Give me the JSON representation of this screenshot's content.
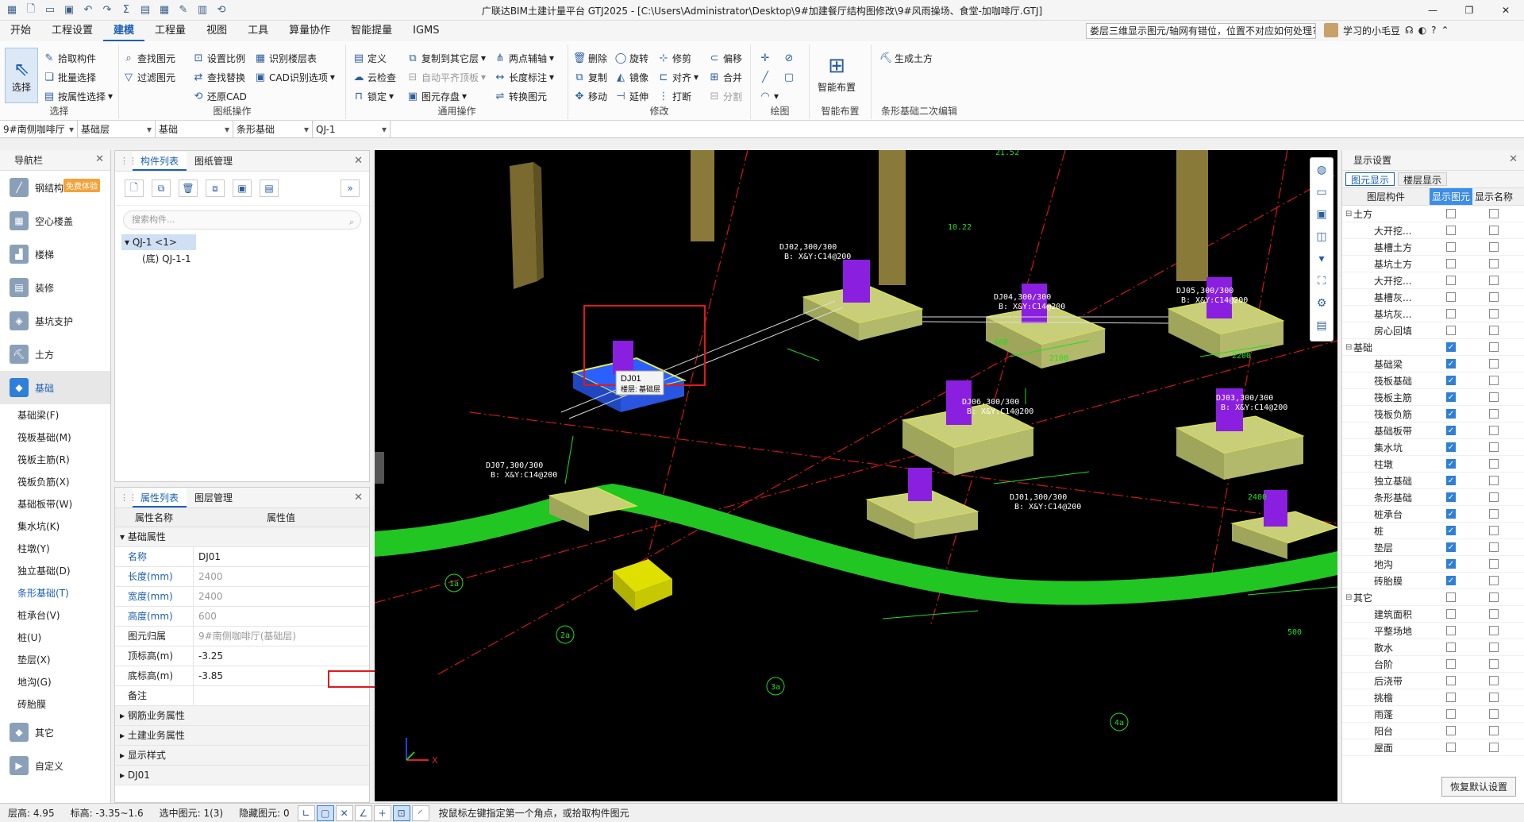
{
  "app": {
    "title": "广联达BIM土建计量平台 GTJ2025 - [C:\\Users\\Administrator\\Desktop\\9#加建餐厅结构图修改\\9#风雨操场、食堂-加咖啡厅.GTJ]"
  },
  "menu": [
    "开始",
    "工程设置",
    "建模",
    "工程量",
    "视图",
    "工具",
    "算量协作",
    "智能提量",
    "IGMS"
  ],
  "menu_active": "建模",
  "question": "娄层三维显示图元/轴网有错位，位置不对应如何处理?",
  "user": "学习的小毛豆",
  "ribbon": {
    "select": {
      "big": "选择",
      "pick": "拾取构件",
      "batch": "批量选择",
      "by_attr": "按属性选择",
      "label": "选择"
    },
    "drawing": {
      "find": "查找图元",
      "filter": "过滤图元",
      "scale": "设置比例",
      "replace": "查找替换",
      "restore": "还原CAD",
      "identify_floor": "识别楼层表",
      "cad_options": "CAD识别选项",
      "label": "图纸操作"
    },
    "common": {
      "define": "定义",
      "copy_to": "复制到其它层",
      "two_point": "两点辅轴",
      "cloud_check": "云检查",
      "auto_align": "自动平齐顶板",
      "length_mark": "长度标注",
      "lock": "锁定",
      "save_elem": "图元存盘",
      "convert": "转换图元",
      "label": "通用操作"
    },
    "modify": {
      "delete": "删除",
      "rotate": "旋转",
      "trim": "修剪",
      "offset": "偏移",
      "copy": "复制",
      "mirror": "镜像",
      "align": "对齐",
      "merge": "合并",
      "move": "移动",
      "extend": "延伸",
      "break": "打断",
      "split": "分割",
      "label": "修改"
    },
    "draw": {
      "label": "绘图"
    },
    "smart": {
      "big": "智能布置",
      "label": "智能布置"
    },
    "strip": {
      "gen": "生成土方",
      "label": "条形基础二次编辑"
    }
  },
  "filters": [
    "9#南侧咖啡厅",
    "基础层",
    "基础",
    "条形基础",
    "QJ-1"
  ],
  "nav": {
    "title": "导航栏",
    "badge": "免费体验",
    "items": [
      "钢结构",
      "空心楼盖",
      "楼梯",
      "装修",
      "基坑支护",
      "土方",
      "基础"
    ],
    "sub": [
      "基础梁(F)",
      "筏板基础(M)",
      "筏板主筋(R)",
      "筏板负筋(X)",
      "基础板带(W)",
      "集水坑(K)",
      "柱墩(Y)",
      "独立基础(D)",
      "条形基础(T)",
      "桩承台(V)",
      "桩(U)",
      "垫层(X)",
      "地沟(G)",
      "砖胎膜"
    ],
    "sub_active": "条形基础(T)",
    "bottom": [
      "其它",
      "自定义"
    ]
  },
  "components": {
    "tabs": [
      "构件列表",
      "图纸管理"
    ],
    "search": "搜索构件...",
    "root": "QJ-1 <1>",
    "child": "(底) QJ-1-1"
  },
  "props": {
    "tabs": [
      "属性列表",
      "图层管理"
    ],
    "col_name": "属性名称",
    "col_value": "属性值",
    "group": "基础属性",
    "rows": [
      {
        "name": "名称",
        "value": "DJ01"
      },
      {
        "name": "长度(mm)",
        "value": "2400"
      },
      {
        "name": "宽度(mm)",
        "value": "2400"
      },
      {
        "name": "高度(mm)",
        "value": "600"
      },
      {
        "name": "图元归属",
        "value": "9#南侧咖啡厅(基础层)"
      },
      {
        "name": "顶标高(m)",
        "value": "-3.25"
      },
      {
        "name": "底标高(m)",
        "value": "-3.85"
      },
      {
        "name": "备注",
        "value": ""
      }
    ],
    "groups": [
      "钢筋业务属性",
      "土建业务属性",
      "显示样式",
      "DJ01"
    ]
  },
  "viewport": {
    "tooltip_name": "DJ01",
    "tooltip_floor": "楼层: 基础层",
    "labels": [
      "DJ04,300/300",
      "B: X&Y:C14@200",
      "DJ05,300/300",
      "B: X&Y:C14@200",
      "DJ06,300/300",
      "B: X&Y:C14@200",
      "DJ03,300/300",
      "B: X&Y:C14@200",
      "DJ01,300/300",
      "B: X&Y:C14@200",
      "DJ07,300/300",
      "B: X&Y:C14@200",
      "DJ02,300/300",
      "B: X&Y:C14@200",
      "2100",
      "2200",
      "2400",
      "400",
      "500",
      "1a",
      "2a",
      "3a",
      "4a",
      "10.22",
      "21.52"
    ]
  },
  "display": {
    "title": "显示设置",
    "tabs": [
      "图元显示",
      "楼层显示"
    ],
    "head": [
      "图层构件",
      "显示图元",
      "显示名称"
    ],
    "rows": [
      {
        "name": "土方",
        "cat": true,
        "show": false
      },
      {
        "name": "大开挖...",
        "show": false
      },
      {
        "name": "基槽土方",
        "show": false
      },
      {
        "name": "基坑土方",
        "show": false
      },
      {
        "name": "大开挖...",
        "show": false
      },
      {
        "name": "基槽灰...",
        "show": false
      },
      {
        "name": "基坑灰...",
        "show": false
      },
      {
        "name": "房心回填",
        "show": false
      },
      {
        "name": "基础",
        "cat": true,
        "show": true
      },
      {
        "name": "基础梁",
        "show": true
      },
      {
        "name": "筏板基础",
        "show": true
      },
      {
        "name": "筏板主筋",
        "show": true
      },
      {
        "name": "筏板负筋",
        "show": true
      },
      {
        "name": "基础板带",
        "show": true
      },
      {
        "name": "集水坑",
        "show": true
      },
      {
        "name": "柱墩",
        "show": true
      },
      {
        "name": "独立基础",
        "show": true
      },
      {
        "name": "条形基础",
        "show": true
      },
      {
        "name": "桩承台",
        "show": true
      },
      {
        "name": "桩",
        "show": true
      },
      {
        "name": "垫层",
        "show": true
      },
      {
        "name": "地沟",
        "show": true
      },
      {
        "name": "砖胎膜",
        "show": true
      },
      {
        "name": "其它",
        "cat": true,
        "show": false
      },
      {
        "name": "建筑面积",
        "show": false
      },
      {
        "name": "平整场地",
        "show": false
      },
      {
        "name": "散水",
        "show": false
      },
      {
        "name": "台阶",
        "show": false
      },
      {
        "name": "后浇带",
        "show": false
      },
      {
        "name": "挑檐",
        "show": false
      },
      {
        "name": "雨蓬",
        "show": false
      },
      {
        "name": "阳台",
        "show": false
      },
      {
        "name": "屋面",
        "show": false
      }
    ],
    "reset": "恢复默认设置"
  },
  "status": {
    "floor_height": "层高: 4.95",
    "elevation": "标高: -3.35~1.6",
    "selected": "选中图元: 1(3)",
    "hidden": "隐藏图元: 0",
    "hint": "按鼠标左键指定第一个角点，或拾取构件图元"
  },
  "colors": {
    "accent": "#1a5fb4",
    "highlight_red": "#e0191d",
    "cad_green": "#22cc22",
    "footing_yellow": "#c8cf78",
    "column_purple": "#8a1fe0"
  }
}
